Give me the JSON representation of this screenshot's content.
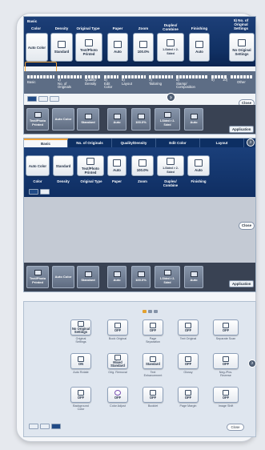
{
  "panel1": {
    "headers": [
      "Basic",
      "Color",
      "Density",
      "Original Type",
      "Paper",
      "Zoom",
      "Duplex/\nCombine",
      "Finishing",
      "5) No. of\nOriginal\nSettings"
    ],
    "tiles": [
      "Auto Color",
      "Standard",
      "Text/Photo\nPrinted",
      "Auto",
      "100.0%",
      "1-Sided > 2-\nSided",
      "Auto",
      "No Original\nSettings"
    ],
    "tab_labels": [
      "Basic",
      "4)\nNo. of\nOriginals",
      "Quality/\nDensity",
      "5)\nEdit\nColor",
      "6)\nLayout",
      "7)\nTailoring",
      "8)\nStamp/\nComposition",
      "9)",
      "10)",
      "Other"
    ],
    "bottom_tiles": [
      "Text/Photo\nPrinted",
      "Auto Color",
      "Standard",
      "Auto",
      "100.0%",
      "1-Sided > 2-\nSided",
      "Auto"
    ],
    "bottom_subs": [
      "Original Type",
      "Color",
      "Density",
      "Paper",
      "Zoom",
      "Duplex/\nCombine",
      "Finishing"
    ],
    "close": "Close",
    "application": "Application"
  },
  "panel2": {
    "tabs": [
      "Basic",
      "No. of Originals",
      "Quality/Density",
      "Edit Color",
      "Layout"
    ],
    "tiles": [
      "Auto Color",
      "Standard",
      "Text/Photo\nPrinted",
      "Auto",
      "100.0%",
      "1-Sided > 2-\nSided",
      "Auto"
    ],
    "subs": [
      "Color",
      "Density",
      "Original Type",
      "Paper",
      "Zoom",
      "Duplex/\nCombine",
      "Finishing"
    ],
    "bottom_tiles": [
      "Text/Photo\nPrinted",
      "Auto Color",
      "Standard",
      "Auto",
      "100.0%",
      "1-Sided > 2-\nSided",
      "Auto"
    ],
    "bottom_subs": [
      "Original Type",
      "Color",
      "Density",
      "Paper",
      "Zoom",
      "Duplex/\nCombine",
      "Finishing"
    ],
    "close": "Close",
    "application": "Application"
  },
  "panel3": {
    "row1": [
      {
        "label": "No Original\nSettings",
        "sub": "Original\nSettings"
      },
      {
        "label": "OFF",
        "sub": "Book Original"
      },
      {
        "label": "OFF",
        "sub": "Page\nSeparation"
      },
      {
        "label": "OFF",
        "sub": "Text Original"
      },
      {
        "label": "OFF",
        "sub": "Separate Scan"
      }
    ],
    "row2": [
      {
        "label": "ON",
        "sub": "Auto Rotate"
      },
      {
        "label": "Mixed\nStandard",
        "sub": "Orig. Removal"
      },
      {
        "label": "Standard",
        "sub": "Text\nEnhancement"
      },
      {
        "label": "OFF",
        "sub": "Glossy"
      },
      {
        "label": "OFF",
        "sub": "Neg-/Pos.\nReverse"
      }
    ],
    "row3": [
      {
        "label": "OFF",
        "sub": "Background\nColor"
      },
      {
        "label": "OFF",
        "sub": "Color Adjust"
      },
      {
        "label": "OFF",
        "sub": "Booklet"
      },
      {
        "label": "OFF",
        "sub": "Page Margin"
      },
      {
        "label": "OFF",
        "sub": "Image Shift"
      }
    ],
    "close": "Close"
  }
}
